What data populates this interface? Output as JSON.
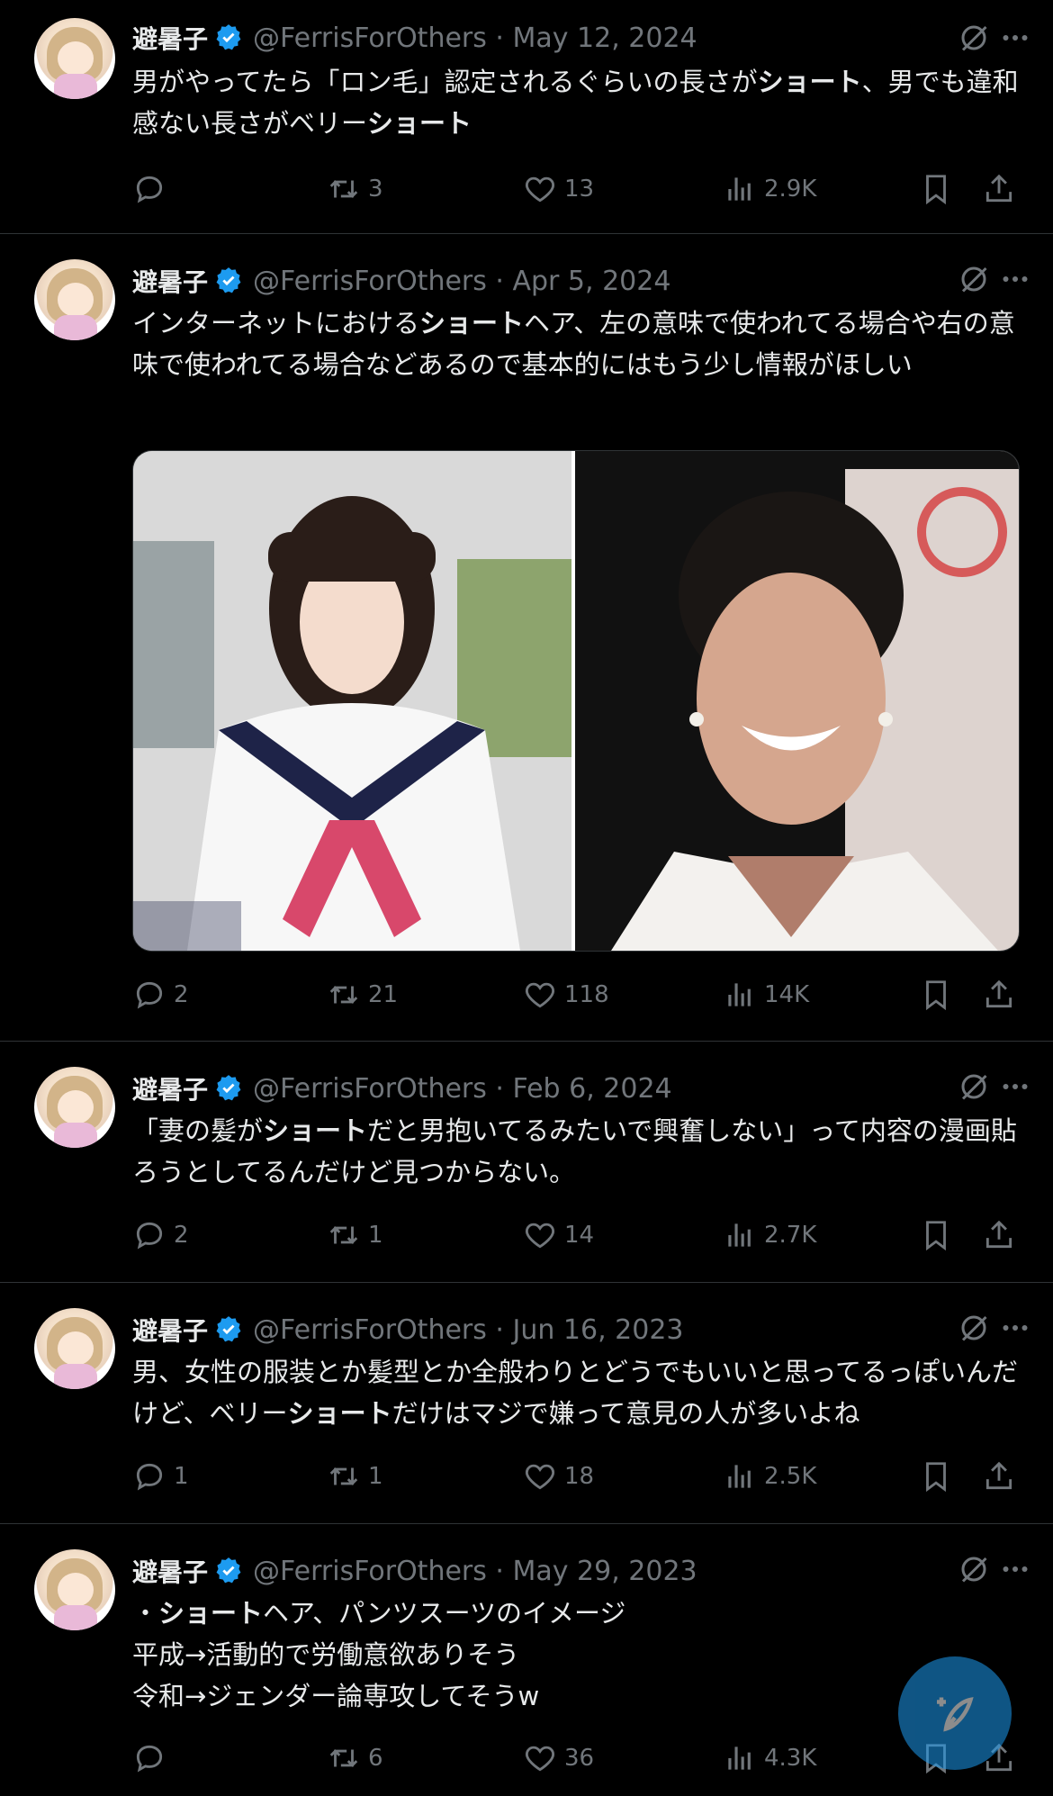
{
  "colors": {
    "background": "#000000",
    "text": "#e7e9ea",
    "muted": "#71767b",
    "accent": "#1d9bf0",
    "divider": "#2f3336"
  },
  "tweets": [
    {
      "name": "避暑子",
      "handle_date": "@FerrisForOthers · May 12, 2024",
      "text_segments": [
        "男がやってたら「ロン毛」認定されるぐらいの長さが",
        "ショート",
        "、男でも違和感ない長さがベリー",
        "ショート"
      ],
      "replies": "",
      "retweets": "3",
      "likes": "13",
      "views": "2.9K"
    },
    {
      "name": "避暑子",
      "handle_date": "@FerrisForOthers · Apr 5, 2024",
      "text_segments": [
        "インターネットにおける",
        "ショート",
        "ヘア、左の意味で使われてる場合や右の意味で使われてる場合などあるので基本的にはもう少し情報がほしい"
      ],
      "replies": "2",
      "retweets": "21",
      "likes": "118",
      "views": "14K"
    },
    {
      "name": "避暑子",
      "handle_date": "@FerrisForOthers · Feb 6, 2024",
      "text_segments": [
        "「妻の髪が",
        "ショート",
        "だと男抱いてるみたいで興奮しない」って内容の漫画貼ろうとしてるんだけど見つからない。"
      ],
      "replies": "2",
      "retweets": "1",
      "likes": "14",
      "views": "2.7K"
    },
    {
      "name": "避暑子",
      "handle_date": "@FerrisForOthers · Jun 16, 2023",
      "text_segments": [
        "男、女性の服装とか髪型とか全般わりとどうでもいいと思ってるっぽいんだけど、ベリー",
        "ショート",
        "だけはマジで嫌って意見の人が多いよね"
      ],
      "replies": "1",
      "retweets": "1",
      "likes": "18",
      "views": "2.5K"
    },
    {
      "name": "避暑子",
      "handle_date": "@FerrisForOthers · May 29, 2023",
      "text_segments": [
        "・",
        "ショート",
        "ヘア、パンツスーツのイメージ\n平成→活動的で労働意欲ありそう\n令和→ジェンダー論専攻してそうw"
      ],
      "replies": "",
      "retweets": "6",
      "likes": "36",
      "views": "4.3K"
    }
  ]
}
